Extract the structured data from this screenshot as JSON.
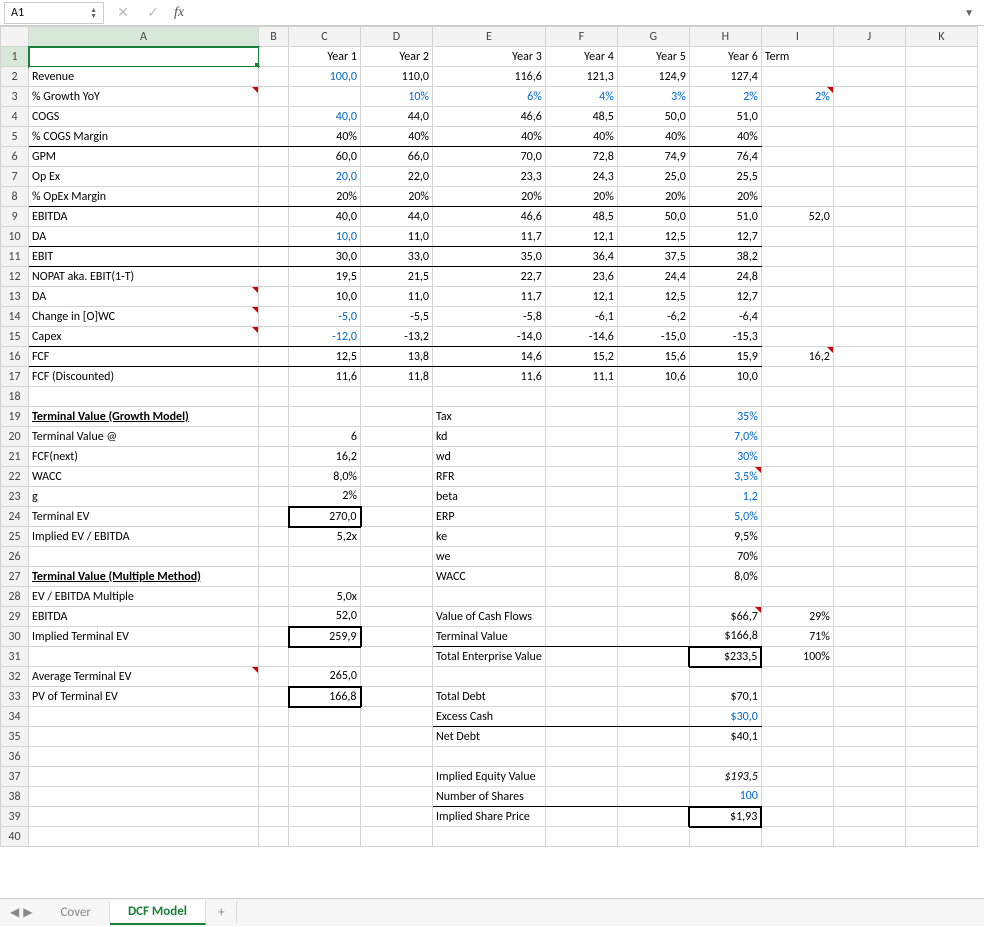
{
  "nameBox": "A1",
  "fx": "fx",
  "tabs": {
    "nav_prev": "◀",
    "nav_next": "▶",
    "cover": "Cover",
    "dcf": "DCF Model",
    "add": "+"
  },
  "colHeaders": [
    "A",
    "B",
    "C",
    "D",
    "E",
    "F",
    "G",
    "H",
    "I",
    "J",
    "K"
  ],
  "rowHeaders": [
    "1",
    "2",
    "3",
    "4",
    "5",
    "6",
    "7",
    "8",
    "9",
    "10",
    "11",
    "12",
    "13",
    "14",
    "15",
    "16",
    "17",
    "18",
    "19",
    "20",
    "21",
    "22",
    "23",
    "24",
    "25",
    "26",
    "27",
    "28",
    "29",
    "30",
    "31",
    "32",
    "33",
    "34",
    "35",
    "36",
    "37",
    "38",
    "39",
    "40"
  ],
  "r1": {
    "c": "Year 1",
    "d": "Year 2",
    "e": "Year 3",
    "f": "Year 4",
    "g": "Year 5",
    "h": "Year 6",
    "i": "Term"
  },
  "r2": {
    "a": "Revenue",
    "c": "100,0",
    "d": "110,0",
    "e": "116,6",
    "f": "121,3",
    "g": "124,9",
    "h": "127,4"
  },
  "r3": {
    "a": "% Growth YoY",
    "d": "10%",
    "e": "6%",
    "f": "4%",
    "g": "3%",
    "h": "2%",
    "i": "2%"
  },
  "r4": {
    "a": "COGS",
    "c": "40,0",
    "d": "44,0",
    "e": "46,6",
    "f": "48,5",
    "g": "50,0",
    "h": "51,0"
  },
  "r5": {
    "a": "% COGS Margin",
    "c": "40%",
    "d": "40%",
    "e": "40%",
    "f": "40%",
    "g": "40%",
    "h": "40%"
  },
  "r6": {
    "a": "GPM",
    "c": "60,0",
    "d": "66,0",
    "e": "70,0",
    "f": "72,8",
    "g": "74,9",
    "h": "76,4"
  },
  "r7": {
    "a": "Op Ex",
    "c": "20,0",
    "d": "22,0",
    "e": "23,3",
    "f": "24,3",
    "g": "25,0",
    "h": "25,5"
  },
  "r8": {
    "a": "% OpEx Margin",
    "c": "20%",
    "d": "20%",
    "e": "20%",
    "f": "20%",
    "g": "20%",
    "h": "20%"
  },
  "r9": {
    "a": "EBITDA",
    "c": "40,0",
    "d": "44,0",
    "e": "46,6",
    "f": "48,5",
    "g": "50,0",
    "h": "51,0",
    "i": "52,0"
  },
  "r10": {
    "a": "DA",
    "c": "10,0",
    "d": "11,0",
    "e": "11,7",
    "f": "12,1",
    "g": "12,5",
    "h": "12,7"
  },
  "r11": {
    "a": "EBIT",
    "c": "30,0",
    "d": "33,0",
    "e": "35,0",
    "f": "36,4",
    "g": "37,5",
    "h": "38,2"
  },
  "r12": {
    "a": "NOPAT aka. EBIT(1-T)",
    "c": "19,5",
    "d": "21,5",
    "e": "22,7",
    "f": "23,6",
    "g": "24,4",
    "h": "24,8"
  },
  "r13": {
    "a": "DA",
    "c": "10,0",
    "d": "11,0",
    "e": "11,7",
    "f": "12,1",
    "g": "12,5",
    "h": "12,7"
  },
  "r14": {
    "a": "Change in [O]WC",
    "c": "-5,0",
    "d": "-5,5",
    "e": "-5,8",
    "f": "-6,1",
    "g": "-6,2",
    "h": "-6,4"
  },
  "r15": {
    "a": "Capex",
    "c": "-12,0",
    "d": "-13,2",
    "e": "-14,0",
    "f": "-14,6",
    "g": "-15,0",
    "h": "-15,3"
  },
  "r16": {
    "a": "FCF",
    "c": "12,5",
    "d": "13,8",
    "e": "14,6",
    "f": "15,2",
    "g": "15,6",
    "h": "15,9",
    "i": "16,2"
  },
  "r17": {
    "a": "FCF (Discounted)",
    "c": "11,6",
    "d": "11,8",
    "e": "11,6",
    "f": "11,1",
    "g": "10,6",
    "h": "10,0"
  },
  "r19": {
    "a": "Terminal Value (Growth Model)",
    "e": "Tax",
    "h": "35%"
  },
  "r20": {
    "a": "Terminal Value @",
    "c": "6",
    "e": "kd",
    "h": "7,0%"
  },
  "r21": {
    "a": "FCF(next)",
    "c": "16,2",
    "e": "wd",
    "h": "30%"
  },
  "r22": {
    "a": "WACC",
    "c": "8,0%",
    "e": "RFR",
    "h": "3,5%"
  },
  "r23": {
    "a": "g",
    "c": "2%",
    "e": "beta",
    "h": "1,2"
  },
  "r24": {
    "a": "Terminal EV",
    "c": "270,0",
    "e": "ERP",
    "h": "5,0%"
  },
  "r25": {
    "a": "Implied EV / EBITDA",
    "c": "5,2x",
    "e": "ke",
    "h": "9,5%"
  },
  "r26": {
    "e": "we",
    "h": "70%"
  },
  "r27": {
    "a": "Terminal Value (Multiple Method)",
    "e": "WACC",
    "h": "8,0%"
  },
  "r28": {
    "a": "EV / EBITDA Multiple",
    "c": "5,0x"
  },
  "r29": {
    "a": "EBITDA",
    "c": "52,0",
    "e": "Value of Cash Flows",
    "h": "$66,7",
    "i": "29%"
  },
  "r30": {
    "a": "Implied Terminal EV",
    "c": "259,9",
    "e": "Terminal Value",
    "h": "$166,8",
    "i": "71%"
  },
  "r31": {
    "e": "Total Enterprise Value",
    "h": "$233,5",
    "i": "100%"
  },
  "r32": {
    "a": "Average Terminal EV",
    "c": "265,0"
  },
  "r33": {
    "a": "PV of Terminal EV",
    "c": "166,8",
    "e": "Total Debt",
    "h": "$70,1"
  },
  "r34": {
    "e": "Excess Cash",
    "h": "$30,0"
  },
  "r35": {
    "e": "Net Debt",
    "h": "$40,1"
  },
  "r37": {
    "e": "Implied Equity Value",
    "h": "$193,5"
  },
  "r38": {
    "e": "Number of Shares",
    "h": "100"
  },
  "r39": {
    "e": "Implied Share Price",
    "h": "$1,93"
  }
}
